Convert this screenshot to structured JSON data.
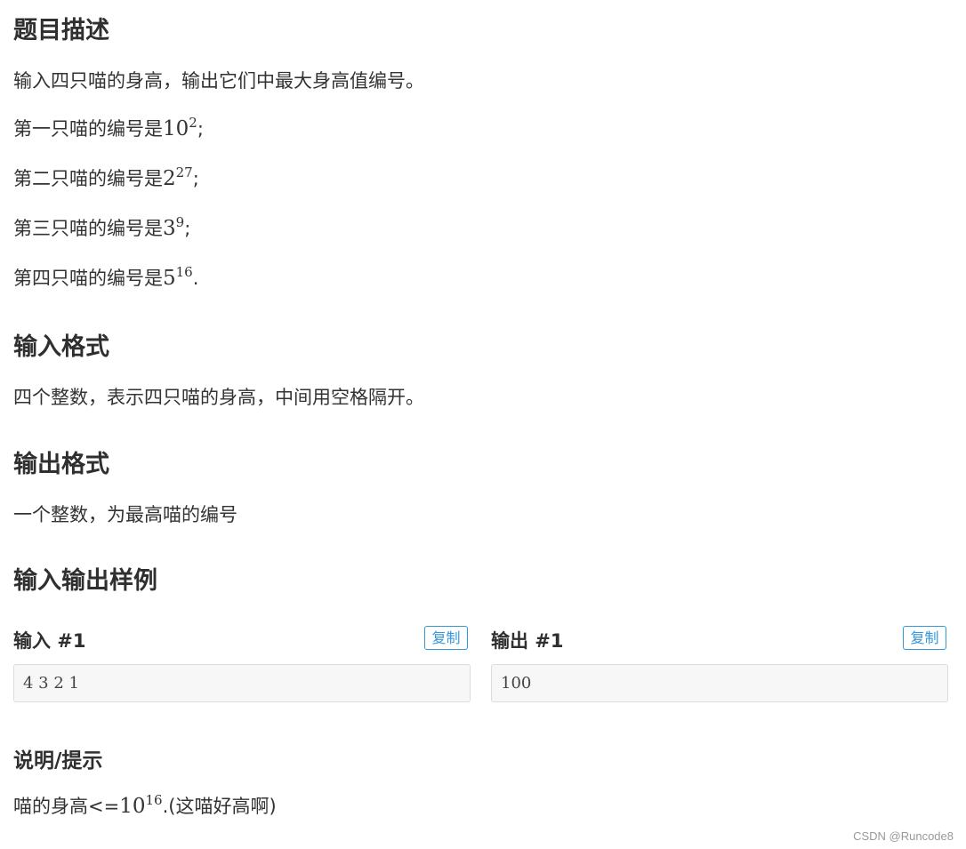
{
  "description": {
    "heading": "题目描述",
    "intro": "输入四只喵的身高，输出它们中最大身高值编号。",
    "items": [
      {
        "prefix": "第一只喵的编号是",
        "base": "10",
        "exp": "2",
        "end": ";"
      },
      {
        "prefix": "第二只喵的编号是",
        "base": "2",
        "exp": "27",
        "end": ";"
      },
      {
        "prefix": "第三只喵的编号是",
        "base": "3",
        "exp": "9",
        "end": ";"
      },
      {
        "prefix": "第四只喵的编号是",
        "base": "5",
        "exp": "16",
        "end": "."
      }
    ]
  },
  "input_format": {
    "heading": "输入格式",
    "text": "四个整数，表示四只喵的身高，中间用空格隔开。"
  },
  "output_format": {
    "heading": "输出格式",
    "text": "一个整数，为最高喵的编号"
  },
  "samples": {
    "heading": "输入输出样例",
    "input": {
      "label": "输入 #1",
      "copy_label": "复制",
      "value": "4 3 2 1"
    },
    "output": {
      "label": "输出 #1",
      "copy_label": "复制",
      "value": "100"
    }
  },
  "hint": {
    "heading": "说明/提示",
    "prefix": "喵的身高<=",
    "base": "10",
    "exp": "16",
    "suffix": ".(这喵好高啊)"
  },
  "watermark": "CSDN @Runcode8",
  "colors": {
    "accent": "#3498db",
    "heading": "#2f2f2f",
    "text": "#333333",
    "sample_bg": "#f7f7f7"
  }
}
